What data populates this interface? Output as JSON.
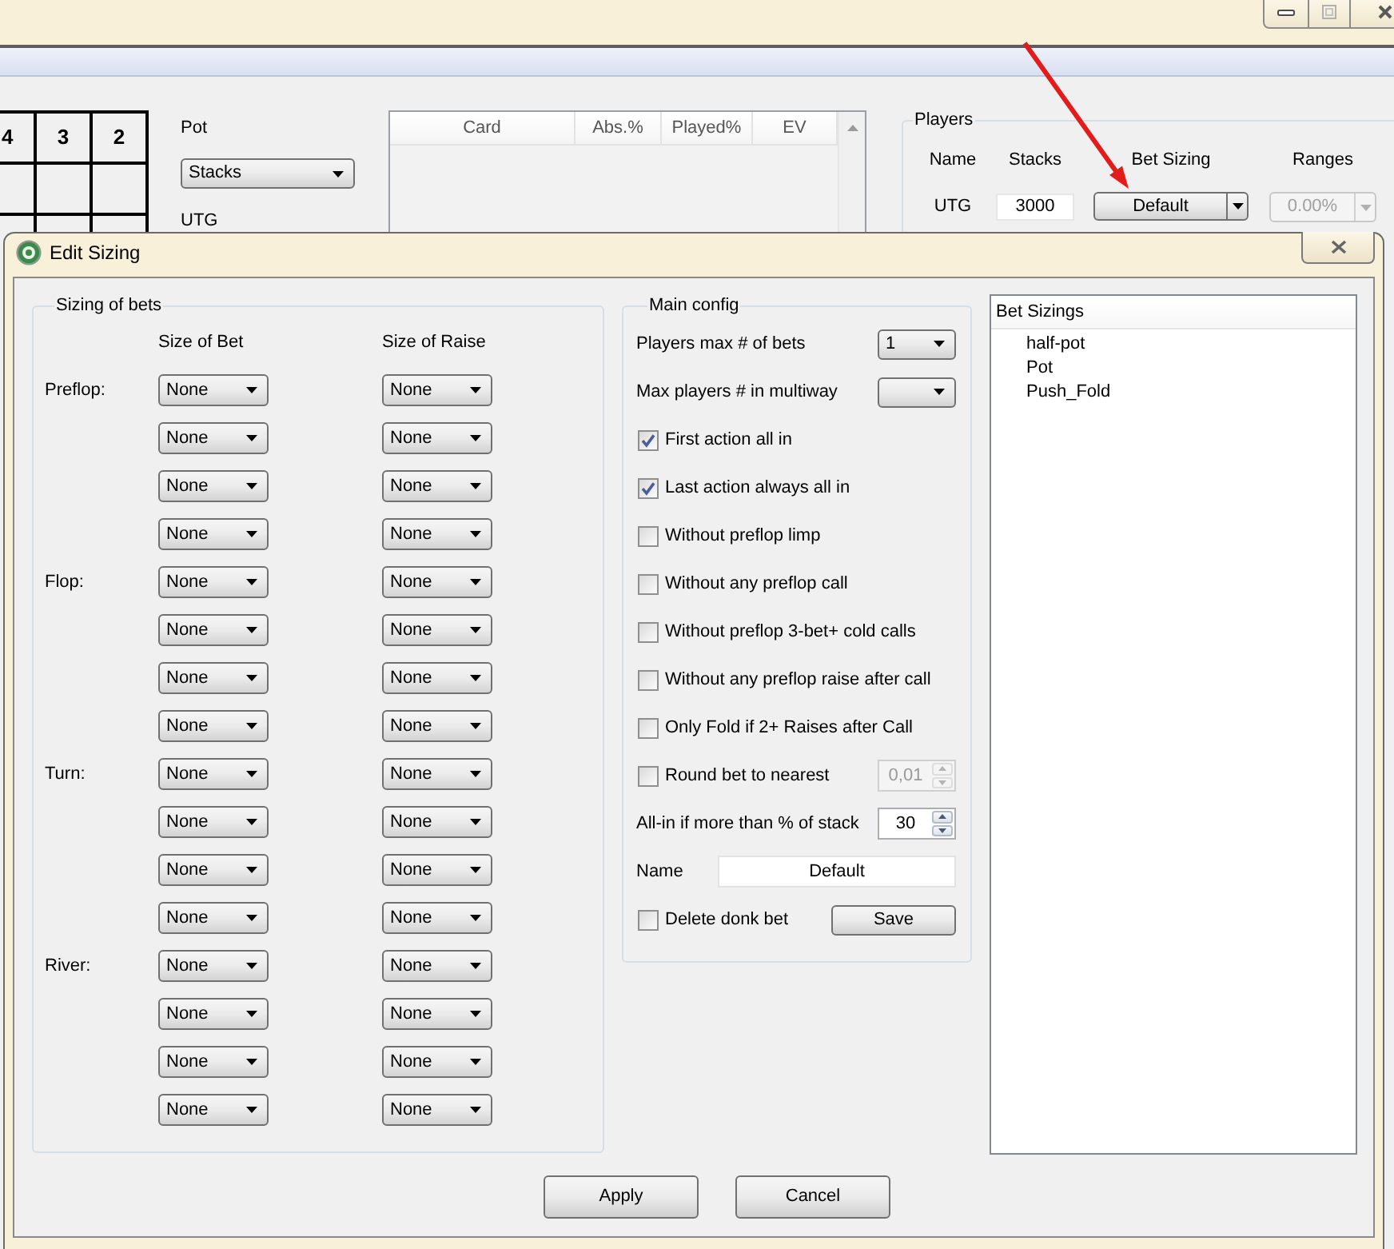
{
  "background_window": {
    "rank_grid": {
      "headers": [
        "4",
        "3",
        "2"
      ]
    },
    "pot": {
      "label": "Pot",
      "select": "Stacks",
      "seat_label": "UTG"
    },
    "card_table": {
      "columns": [
        "Card",
        "Abs.%",
        "Played%",
        "EV"
      ]
    },
    "players": {
      "title": "Players",
      "columns": [
        "Name",
        "Stacks",
        "Bet Sizing",
        "Ranges"
      ],
      "rows": [
        {
          "name": "UTG",
          "stack": "3000",
          "bet_sizing": "Default",
          "range": "0.00%",
          "range_disabled": true
        }
      ]
    }
  },
  "dialog": {
    "title": "Edit Sizing",
    "sizing_of_bets": {
      "title": "Sizing of bets",
      "columns": [
        "Size of Bet",
        "Size of Raise"
      ],
      "streets": [
        {
          "label": "Preflop:",
          "rows": [
            {
              "bet": "None",
              "raise": "None"
            },
            {
              "bet": "None",
              "raise": "None"
            },
            {
              "bet": "None",
              "raise": "None"
            },
            {
              "bet": "None",
              "raise": "None"
            }
          ]
        },
        {
          "label": "Flop:",
          "rows": [
            {
              "bet": "None",
              "raise": "None"
            },
            {
              "bet": "None",
              "raise": "None"
            },
            {
              "bet": "None",
              "raise": "None"
            },
            {
              "bet": "None",
              "raise": "None"
            }
          ]
        },
        {
          "label": "Turn:",
          "rows": [
            {
              "bet": "None",
              "raise": "None"
            },
            {
              "bet": "None",
              "raise": "None"
            },
            {
              "bet": "None",
              "raise": "None"
            },
            {
              "bet": "None",
              "raise": "None"
            }
          ]
        },
        {
          "label": "River:",
          "rows": [
            {
              "bet": "None",
              "raise": "None"
            },
            {
              "bet": "None",
              "raise": "None"
            },
            {
              "bet": "None",
              "raise": "None"
            },
            {
              "bet": "None",
              "raise": "None"
            }
          ]
        }
      ]
    },
    "main_config": {
      "title": "Main config",
      "items": [
        {
          "kind": "select",
          "label": "Players max # of bets",
          "value": "1"
        },
        {
          "kind": "select",
          "label": "Max players # in multiway"
        },
        {
          "kind": "checkbox",
          "label": "First action all in",
          "checked": true
        },
        {
          "kind": "checkbox",
          "label": "Last action always all in",
          "checked": true
        },
        {
          "kind": "checkbox",
          "label": "Without preflop limp",
          "checked": false
        },
        {
          "kind": "checkbox",
          "label": "Without any preflop call",
          "checked": false
        },
        {
          "kind": "checkbox",
          "label": "Without preflop 3-bet+ cold calls",
          "checked": false
        },
        {
          "kind": "checkbox",
          "label": "Without any preflop raise after call",
          "checked": false
        },
        {
          "kind": "checkbox",
          "label": "Only Fold if 2+ Raises after Call",
          "checked": false
        },
        {
          "kind": "checkbox",
          "label": "Round bet to nearest",
          "checked": false,
          "spin": {
            "value": "0,01",
            "disabled": true
          }
        },
        {
          "kind": "spin",
          "label": "All-in if more than % of stack",
          "spin": {
            "value": "30",
            "disabled": false
          }
        },
        {
          "kind": "field",
          "label": "Name",
          "value": "Default"
        },
        {
          "kind": "checkbox",
          "label": "Delete donk bet",
          "checked": false,
          "button": "Save"
        }
      ]
    },
    "bet_sizings": {
      "header": "Bet Sizings",
      "items": [
        {
          "label": "half-pot",
          "selected": false
        },
        {
          "label": "Pot",
          "selected": false
        },
        {
          "label": "Push_Fold",
          "selected": false
        }
      ]
    },
    "buttons": [
      "Apply",
      "Cancel"
    ]
  }
}
